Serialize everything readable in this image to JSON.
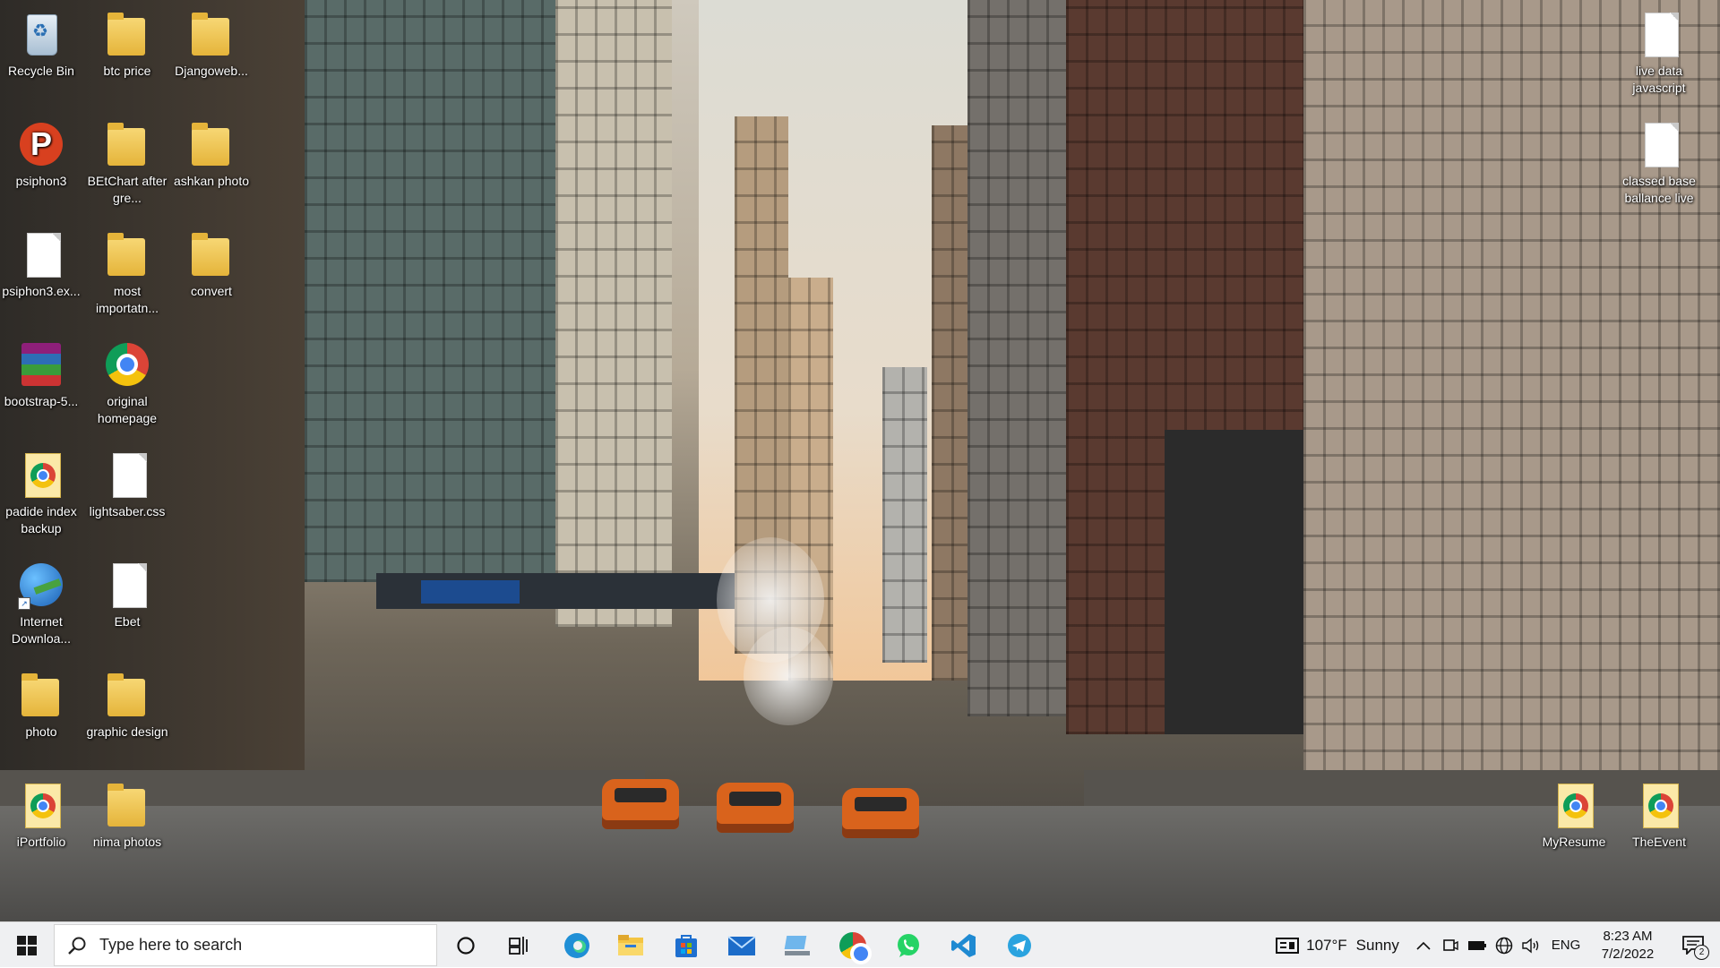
{
  "desktop": {
    "icons": [
      {
        "label": "Recycle Bin",
        "icon": "recycle-bin-icon"
      },
      {
        "label": "btc price",
        "icon": "folder-icon"
      },
      {
        "label": "Djangoweb...",
        "icon": "folder-icon"
      },
      {
        "label": "psiphon3",
        "icon": "psiphon-icon"
      },
      {
        "label": "BEtChart after gre...",
        "icon": "folder-icon"
      },
      {
        "label": "ashkan photo",
        "icon": "folder-icon"
      },
      {
        "label": "psiphon3.ex...",
        "icon": "file-icon"
      },
      {
        "label": "most importatn...",
        "icon": "folder-icon"
      },
      {
        "label": "convert",
        "icon": "folder-icon"
      },
      {
        "label": "bootstrap-5...",
        "icon": "winrar-archive-icon"
      },
      {
        "label": "original homepage",
        "icon": "chrome-icon"
      },
      {
        "label": "padide index backup",
        "icon": "chrome-html-icon"
      },
      {
        "label": "lightsaber.css",
        "icon": "file-icon"
      },
      {
        "label": "Internet Downloa...",
        "icon": "internet-download-manager-icon"
      },
      {
        "label": "Ebet",
        "icon": "file-icon"
      },
      {
        "label": "photo",
        "icon": "folder-icon"
      },
      {
        "label": "graphic design",
        "icon": "folder-icon"
      },
      {
        "label": "iPortfolio",
        "icon": "chrome-html-icon"
      },
      {
        "label": "nima photos",
        "icon": "folder-icon"
      },
      {
        "label": "live data javascript",
        "icon": "file-icon"
      },
      {
        "label": "classed base ballance live",
        "icon": "file-icon"
      },
      {
        "label": "MyResume",
        "icon": "chrome-html-icon"
      },
      {
        "label": "TheEvent",
        "icon": "chrome-html-icon"
      }
    ]
  },
  "taskbar": {
    "search_placeholder": "Type here to search",
    "pinned_apps": [
      "cortana-icon",
      "task-view-icon",
      "edge-icon",
      "file-explorer-icon",
      "microsoft-store-icon",
      "mail-icon",
      "this-pc-icon",
      "chrome-icon",
      "whatsapp-icon",
      "vscode-icon",
      "telegram-icon"
    ],
    "weather": {
      "temp": "107°F",
      "condition": "Sunny"
    },
    "language": "ENG",
    "time": "8:23 AM",
    "date": "7/2/2022",
    "notification_count": "2"
  },
  "colors": {
    "taskbar_bg": "#eff0f2",
    "accent": "#0078d4"
  }
}
